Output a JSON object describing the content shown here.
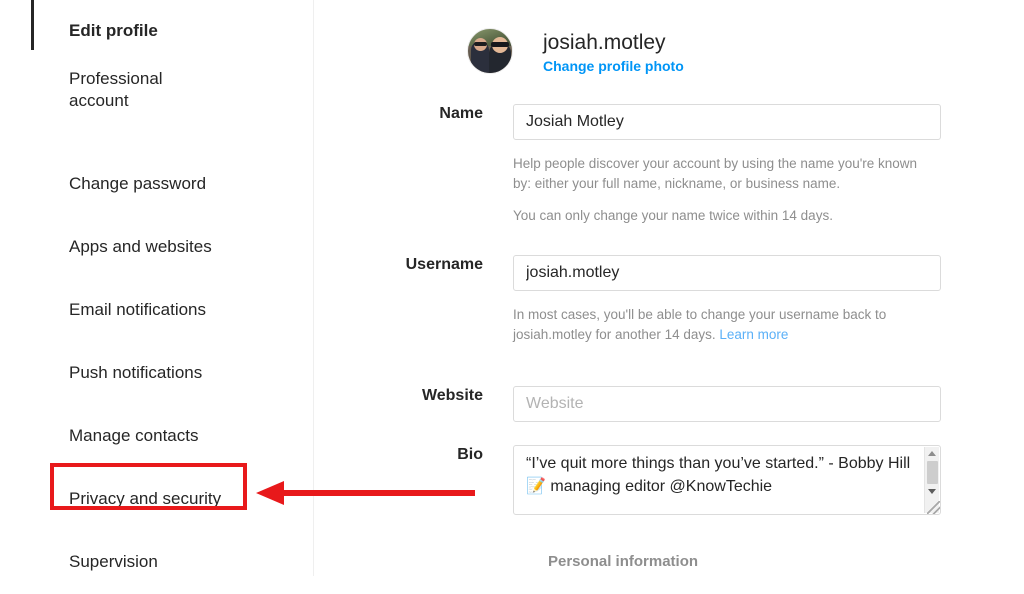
{
  "sidebar": {
    "items": [
      {
        "label": "Edit profile",
        "active": true,
        "two_line": false
      },
      {
        "label": "Professional account",
        "active": false,
        "two_line": true
      },
      {
        "label": "Change password",
        "active": false,
        "two_line": false
      },
      {
        "label": "Apps and websites",
        "active": false,
        "two_line": false
      },
      {
        "label": "Email notifications",
        "active": false,
        "two_line": false
      },
      {
        "label": "Push notifications",
        "active": false,
        "two_line": false
      },
      {
        "label": "Manage contacts",
        "active": false,
        "two_line": false
      },
      {
        "label": "Privacy and security",
        "active": false,
        "two_line": false
      },
      {
        "label": "Supervision",
        "active": false,
        "two_line": false
      }
    ]
  },
  "annotation": {
    "highlight_target": "Privacy and security",
    "color": "#e8191b",
    "arrow_direction": "left"
  },
  "profile": {
    "username": "josiah.motley",
    "change_photo_label": "Change profile photo",
    "avatar_alt": "profile-photo"
  },
  "form": {
    "name": {
      "label": "Name",
      "value": "Josiah Motley",
      "placeholder": "Name",
      "helper_1": "Help people discover your account by using the name you're known by: either your full name, nickname, or business name.",
      "helper_2": "You can only change your name twice within 14 days."
    },
    "username": {
      "label": "Username",
      "value": "josiah.motley",
      "placeholder": "Username",
      "helper_prefix": "In most cases, you'll be able to change your username back to josiah.motley for another 14 days. ",
      "helper_link": "Learn more"
    },
    "website": {
      "label": "Website",
      "value": "",
      "placeholder": "Website"
    },
    "bio": {
      "label": "Bio",
      "value": "“I’ve quit more things than you’ve started.” - Bobby Hill\n📝 managing editor @KnowTechie"
    }
  },
  "section": {
    "personal_information": "Personal information"
  },
  "colors": {
    "link_blue": "#0095f6",
    "helper_gray": "#8e8e8e",
    "annotation_red": "#e8191b",
    "text_dark": "#262626",
    "border_gray": "#dbdbdb"
  }
}
